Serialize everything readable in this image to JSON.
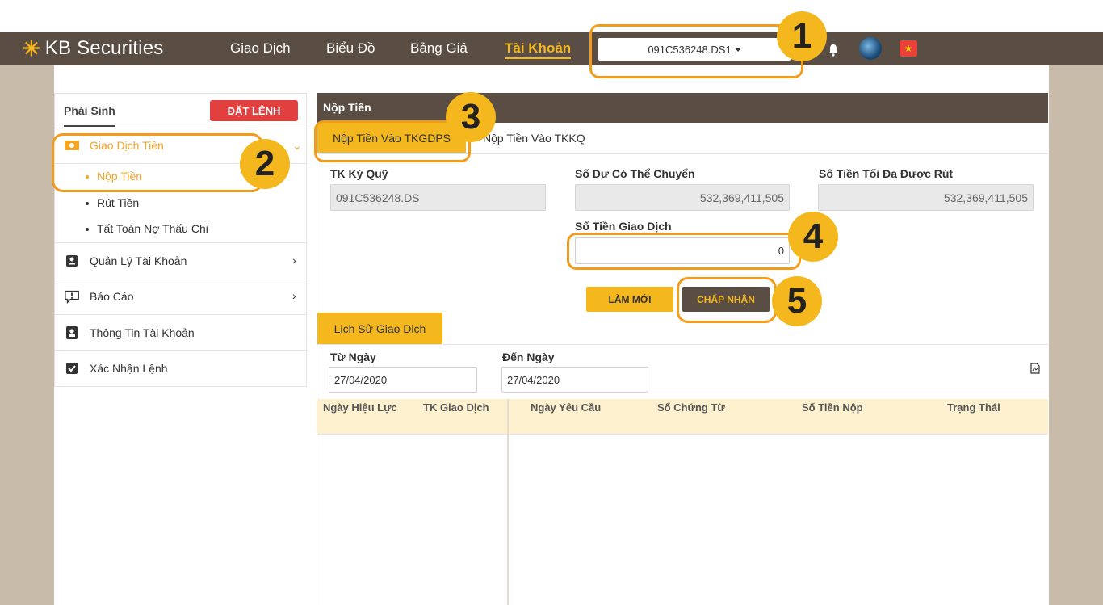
{
  "header": {
    "logo_text": "KB Securities",
    "nav": [
      "Giao Dịch",
      "Biểu Đồ",
      "Bảng Giá",
      "Tài Khoản"
    ],
    "active_nav": "Tài Khoản",
    "account_select": "091C536248.DS1"
  },
  "sidebar": {
    "title": "Phái Sinh",
    "order_button": "ĐẶT LỆNH",
    "items": [
      {
        "label": "Giao Dịch Tiền",
        "icon": "money-icon",
        "active": true
      },
      {
        "label": "Quản Lý Tài Khoản",
        "icon": "account-card-icon"
      },
      {
        "label": "Báo Cáo",
        "icon": "report-icon"
      },
      {
        "label": "Thông Tin Tài Khoản",
        "icon": "user-badge-icon"
      },
      {
        "label": "Xác Nhận Lệnh",
        "icon": "checkbox-icon"
      }
    ],
    "sub_items": [
      {
        "label": "Nộp Tiền",
        "active": true
      },
      {
        "label": "Rút Tiền"
      },
      {
        "label": "Tất Toán Nợ Thấu Chi"
      }
    ]
  },
  "panel": {
    "title": "Nộp Tiền",
    "tabs": [
      "Nộp Tiền Vào TKGDPS",
      "Nộp Tiền Vào TKKQ"
    ],
    "fields": {
      "margin_account_label": "TK Ký Quỹ",
      "margin_account_value": "091C536248.DS",
      "transferable_label": "Số Dư Có Thể Chuyển",
      "transferable_value": "532,369,411,505",
      "max_withdraw_label": "Số Tiền Tối Đa Được Rút",
      "max_withdraw_value": "532,369,411,505",
      "amount_label": "Số Tiền Giao Dịch",
      "amount_value": "0"
    },
    "buttons": {
      "refresh": "LÀM MỚI",
      "accept": "CHẤP NHẬN"
    },
    "history": {
      "tab": "Lịch Sử Giao Dịch",
      "from_label": "Từ Ngày",
      "from_value": "27/04/2020",
      "to_label": "Đến Ngày",
      "to_value": "27/04/2020",
      "columns": [
        "Ngày Hiệu Lực",
        "TK Giao Dịch",
        "Ngày Yêu Cầu",
        "Số Chứng Từ",
        "Số Tiền Nộp",
        "Trạng Thái"
      ]
    }
  },
  "annotations": [
    "1",
    "2",
    "3",
    "4",
    "5"
  ],
  "colors": {
    "brand_brown": "#5a4e44",
    "accent_yellow": "#f5b71e",
    "annotation_orange": "#f39c1b",
    "danger_red": "#e23f3f"
  }
}
